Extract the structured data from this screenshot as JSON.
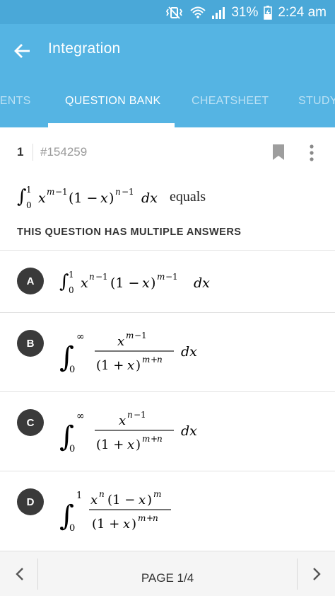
{
  "status_bar": {
    "battery": "31%",
    "time": "2:24 am",
    "icons": [
      "mute-vibrate-icon",
      "wifi-icon",
      "signal-icon",
      "battery-charging-icon"
    ]
  },
  "app_bar": {
    "title": "Integration",
    "back_icon": "arrow-left-icon"
  },
  "tabs": [
    {
      "label": "IENTS",
      "active": false
    },
    {
      "label": "QUESTION BANK",
      "active": true
    },
    {
      "label": "CHEATSHEET",
      "active": false
    },
    {
      "label": "STUDY",
      "active": false
    }
  ],
  "question": {
    "number": "1",
    "id": "#154259",
    "text_suffix": "equals",
    "multiple_answers_note": "THIS QUESTION HAS MULTIPLE ANSWERS"
  },
  "options": [
    {
      "letter": "A"
    },
    {
      "letter": "B"
    },
    {
      "letter": "C"
    },
    {
      "letter": "D"
    }
  ],
  "pager": {
    "label": "PAGE 1/4"
  },
  "colors": {
    "status_bar": "#4aa8d8",
    "app_bar": "#55b4e3",
    "option_circle": "#3a3a3a"
  }
}
